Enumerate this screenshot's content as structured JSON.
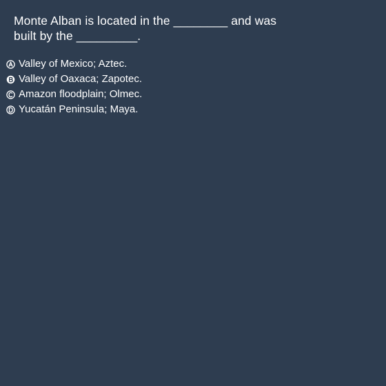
{
  "question": {
    "line1": "Monte Alban is located in the ________ and was",
    "line2": "built by the _________."
  },
  "options": [
    {
      "letter": "A",
      "icon": "option-a-icon",
      "text": "Valley of Mexico; Aztec."
    },
    {
      "letter": "B",
      "icon": "option-b-icon",
      "text": "Valley of Oaxaca; Zapotec."
    },
    {
      "letter": "C",
      "icon": "option-c-icon",
      "text": "Amazon floodplain; Olmec."
    },
    {
      "letter": "D",
      "icon": "option-d-icon",
      "text": "Yucatán Peninsula; Maya."
    }
  ],
  "colors": {
    "background": "#2e3d50",
    "text": "#ffffff"
  }
}
